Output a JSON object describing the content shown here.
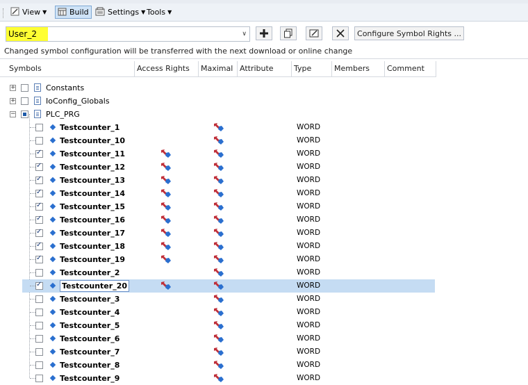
{
  "toolbar": {
    "view_label": "View",
    "build_label": "Build",
    "settings_label": "Settings",
    "tools_label": "Tools"
  },
  "selector": {
    "user_value": "User_2",
    "configure_label": "Configure Symbol Rights ..."
  },
  "info_text": "Changed symbol configuration will be transferred with the next download or online change",
  "columns": {
    "symbols": "Symbols",
    "access_rights": "Access Rights",
    "maximal": "Maximal",
    "attribute": "Attribute",
    "type": "Type",
    "members": "Members",
    "comment": "Comment"
  },
  "tree_root_nodes": [
    {
      "label": "Constants",
      "expanded": false,
      "checkbox": "unchecked"
    },
    {
      "label": "IoConfig_Globals",
      "expanded": false,
      "checkbox": "unchecked"
    },
    {
      "label": "PLC_PRG",
      "expanded": true,
      "checkbox": "partial"
    }
  ],
  "symbols": [
    {
      "name": "Testcounter_1",
      "checked": false,
      "access": false,
      "maximal": true,
      "type": "WORD"
    },
    {
      "name": "Testcounter_10",
      "checked": false,
      "access": false,
      "maximal": true,
      "type": "WORD"
    },
    {
      "name": "Testcounter_11",
      "checked": true,
      "access": true,
      "maximal": true,
      "type": "WORD"
    },
    {
      "name": "Testcounter_12",
      "checked": true,
      "access": true,
      "maximal": true,
      "type": "WORD"
    },
    {
      "name": "Testcounter_13",
      "checked": true,
      "access": true,
      "maximal": true,
      "type": "WORD"
    },
    {
      "name": "Testcounter_14",
      "checked": true,
      "access": true,
      "maximal": true,
      "type": "WORD"
    },
    {
      "name": "Testcounter_15",
      "checked": true,
      "access": true,
      "maximal": true,
      "type": "WORD"
    },
    {
      "name": "Testcounter_16",
      "checked": true,
      "access": true,
      "maximal": true,
      "type": "WORD"
    },
    {
      "name": "Testcounter_17",
      "checked": true,
      "access": true,
      "maximal": true,
      "type": "WORD"
    },
    {
      "name": "Testcounter_18",
      "checked": true,
      "access": true,
      "maximal": true,
      "type": "WORD"
    },
    {
      "name": "Testcounter_19",
      "checked": true,
      "access": true,
      "maximal": true,
      "type": "WORD"
    },
    {
      "name": "Testcounter_2",
      "checked": false,
      "access": false,
      "maximal": true,
      "type": "WORD"
    },
    {
      "name": "Testcounter_20",
      "checked": true,
      "access": true,
      "maximal": true,
      "type": "WORD",
      "selected": true
    },
    {
      "name": "Testcounter_3",
      "checked": false,
      "access": false,
      "maximal": true,
      "type": "WORD"
    },
    {
      "name": "Testcounter_4",
      "checked": false,
      "access": false,
      "maximal": true,
      "type": "WORD"
    },
    {
      "name": "Testcounter_5",
      "checked": false,
      "access": false,
      "maximal": true,
      "type": "WORD"
    },
    {
      "name": "Testcounter_6",
      "checked": false,
      "access": false,
      "maximal": true,
      "type": "WORD"
    },
    {
      "name": "Testcounter_7",
      "checked": false,
      "access": false,
      "maximal": true,
      "type": "WORD"
    },
    {
      "name": "Testcounter_8",
      "checked": false,
      "access": false,
      "maximal": true,
      "type": "WORD"
    },
    {
      "name": "Testcounter_9",
      "checked": false,
      "access": false,
      "maximal": true,
      "type": "WORD"
    }
  ],
  "colors": {
    "selection": "#c5dcf3",
    "highlight": "#ffff33",
    "diamond": "#2a6fcf",
    "arrow_red": "#c0303a",
    "arrow_blue": "#2a6fcf"
  }
}
